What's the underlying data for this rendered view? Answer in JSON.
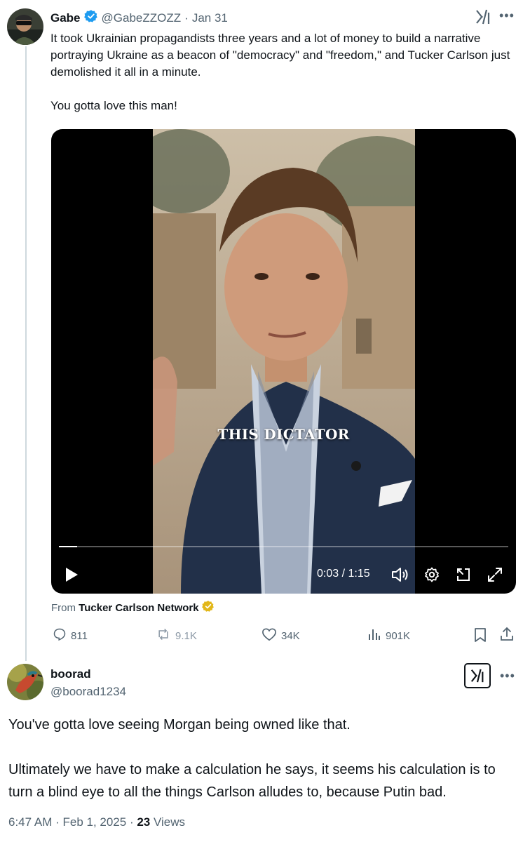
{
  "colors": {
    "verified": "#1d9bf0",
    "gold_badge": "#e2b719",
    "muted": "#536471",
    "divider": "#cfd9de"
  },
  "tweet": {
    "author_name": "Gabe",
    "author_handle": "@GabeZZOZZ",
    "separator": "·",
    "date": "Jan 31",
    "text": "It took Ukrainian propagandists three years and a lot of money to build a narrative portraying Ukraine as a beacon of \"democracy\" and \"freedom,\" and Tucker Carlson just demolished it all in a minute.\n\nYou gotta love this man!",
    "video": {
      "caption": "THIS DICTATOR",
      "current_time": "0:03",
      "time_separator": " / ",
      "duration": "1:15",
      "progress": 0.04
    },
    "source_prefix": "From ",
    "source_name": "Tucker Carlson Network",
    "stats": {
      "replies": "811",
      "reposts": "9.1K",
      "likes": "34K",
      "views": "901K"
    }
  },
  "reply": {
    "author_name": "boorad",
    "author_handle": "@boorad1234",
    "text": "You've gotta love seeing Morgan being owned like that.\n\nUltimately we have to make a calculation he says, it seems his calculation is to turn a blind eye to all the things Carlson alludes to, because Putin bad.",
    "time": "6:47 AM",
    "separator1": " · ",
    "date": "Feb 1, 2025",
    "separator2": " · ",
    "views_count": "23",
    "views_label": " Views"
  }
}
